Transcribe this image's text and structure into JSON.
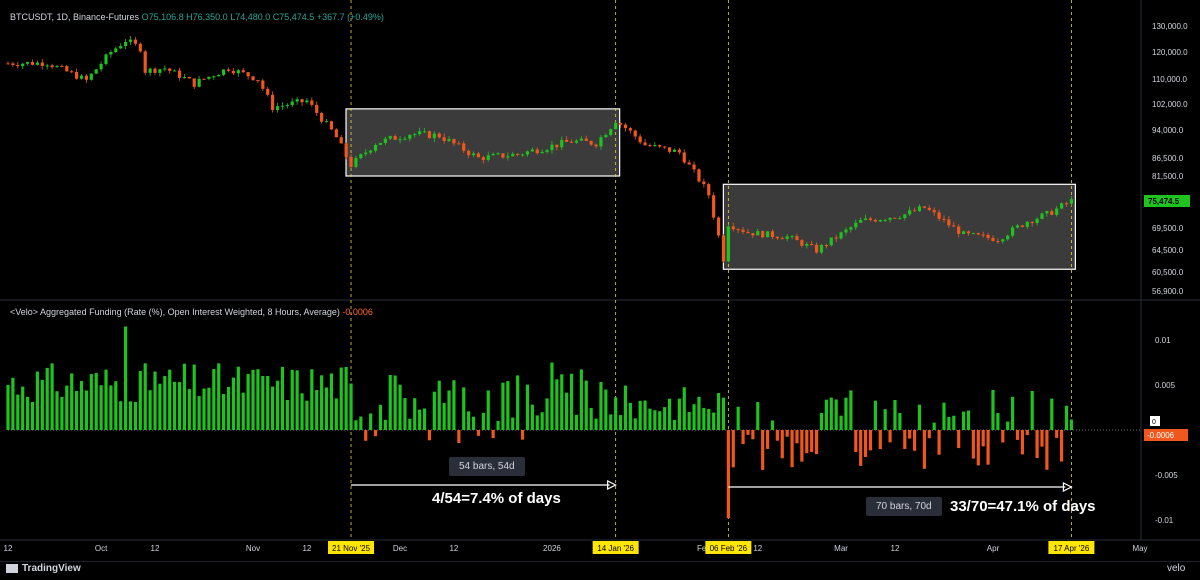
{
  "header": {
    "symbol": "BTCUSDT, 1D, Binance-Futures",
    "open": "O75,106.8",
    "high": "H76,350.0",
    "low": "L74,480.0",
    "close": "C75,474.5",
    "change": "+367.7 (+0.49%)"
  },
  "indicator": {
    "name": "<Velo> Aggregated Funding (Rate (%), Open Interest Weighted, 8 Hours, Average)",
    "value": "-0.0006"
  },
  "annotations": {
    "box1_label": "54 bars, 54d",
    "box1_text": "4/54=7.4% of days",
    "box2_label": "70 bars, 70d",
    "box2_text": "33/70=47.1% of days"
  },
  "colors": {
    "up": "#1ec31e",
    "down": "#f0571d",
    "box_fill": "#3b3b3b",
    "vline": "#e8d63a"
  },
  "footer": {
    "brand": "TradingView",
    "watermark": "velo"
  },
  "chart_data": [
    {
      "type": "candlestick",
      "title": "BTCUSDT, 1D, Binance-Futures",
      "x_range": [
        "2025-09-12",
        "2026-05-01"
      ],
      "price_axis_ticks": [
        130000,
        120000,
        110000,
        102000,
        94000,
        86500,
        81500,
        75474.5,
        69500,
        64500,
        60500,
        56900
      ],
      "price_axis_labels": [
        "130,000.0",
        "120,000.0",
        "110,000.0",
        "102,000.0",
        "94,000.0",
        "86,500.0",
        "81,500.0",
        "75,474.5",
        "69,500.0",
        "64,500.0",
        "60,500.0",
        "56,900.0"
      ],
      "last_price": 75474.5,
      "close_anchors": [
        [
          "2025-09-12",
          115800
        ],
        [
          "2025-09-20",
          116000
        ],
        [
          "2025-09-28",
          109500
        ],
        [
          "2025-10-03",
          120000
        ],
        [
          "2025-10-06",
          124500
        ],
        [
          "2025-10-09",
          121500
        ],
        [
          "2025-10-10",
          113000
        ],
        [
          "2025-10-14",
          114000
        ],
        [
          "2025-10-20",
          108500
        ],
        [
          "2025-10-27",
          114000
        ],
        [
          "2025-11-02",
          110000
        ],
        [
          "2025-11-05",
          101000
        ],
        [
          "2025-11-12",
          103000
        ],
        [
          "2025-11-18",
          92000
        ],
        [
          "2025-11-21",
          84500
        ],
        [
          "2025-11-26",
          90500
        ],
        [
          "2025-12-03",
          93000
        ],
        [
          "2025-12-09",
          92500
        ],
        [
          "2025-12-17",
          86500
        ],
        [
          "2025-12-25",
          87500
        ],
        [
          "2026-01-05",
          91000
        ],
        [
          "2026-01-10",
          90500
        ],
        [
          "2026-01-13",
          95000
        ],
        [
          "2026-01-14",
          97000
        ],
        [
          "2026-01-20",
          90000
        ],
        [
          "2026-01-27",
          88000
        ],
        [
          "2026-02-02",
          77000
        ],
        [
          "2026-02-05",
          63000
        ],
        [
          "2026-02-06",
          70500
        ],
        [
          "2026-02-10",
          68500
        ],
        [
          "2026-02-18",
          67500
        ],
        [
          "2026-02-24",
          64500
        ],
        [
          "2026-03-05",
          71000
        ],
        [
          "2026-03-14",
          72500
        ],
        [
          "2026-03-18",
          74000
        ],
        [
          "2026-03-26",
          68000
        ],
        [
          "2026-04-02",
          67000
        ],
        [
          "2026-04-08",
          71000
        ],
        [
          "2026-04-12",
          72500
        ],
        [
          "2026-04-17",
          75474.5
        ]
      ],
      "annotation_boxes": [
        {
          "from": "2025-11-21",
          "to": "2026-01-14",
          "low": 81500,
          "high": 100500
        },
        {
          "from": "2026-02-06",
          "to": "2026-04-17",
          "low": 61000,
          "high": 79500
        }
      ]
    },
    {
      "type": "bar",
      "title": "<Velo> Aggregated Funding (Rate (%), Open Interest Weighted, 8 Hours, Average)",
      "y_ticks": [
        0.01,
        0.005,
        0,
        -0.005,
        -0.01
      ],
      "y_tick_labels": [
        "0.01",
        "0.005",
        "0",
        "-0.005",
        "-0.01"
      ],
      "ylim": [
        -0.011,
        0.012
      ],
      "last_value": -0.0006,
      "note": "daily funding rate; green = positive, orange = negative",
      "negative_day_counts": [
        {
          "period": "2025-11-21 to 2026-01-14",
          "negative": 4,
          "total": 54,
          "pct": 7.4
        },
        {
          "period": "2026-02-06 to 2026-04-17",
          "negative": 33,
          "total": 70,
          "pct": 47.1
        }
      ],
      "sample_values": [
        [
          "2025-10-06",
          0.0115
        ],
        [
          "2025-10-12",
          0.0065
        ],
        [
          "2025-11-03",
          0.006
        ],
        [
          "2025-11-24",
          -0.0012
        ],
        [
          "2025-12-10",
          0.003
        ],
        [
          "2026-01-01",
          0.0075
        ],
        [
          "2026-02-06",
          -0.0098
        ],
        [
          "2026-03-06",
          -0.003
        ],
        [
          "2026-04-15",
          -0.0035
        ]
      ]
    }
  ],
  "x_axis": {
    "labels": [
      [
        "2025-09-12",
        "12"
      ],
      [
        "2025-10-01",
        "Oct"
      ],
      [
        "2025-10-12",
        "12"
      ],
      [
        "2025-11-01",
        "Nov"
      ],
      [
        "2025-11-12",
        "12"
      ],
      [
        "2025-12-01",
        "Dec"
      ],
      [
        "2025-12-12",
        "12"
      ],
      [
        "2026-01-01",
        "2026"
      ],
      [
        "2026-02-01",
        "Feb"
      ],
      [
        "2026-02-12",
        "12"
      ],
      [
        "2026-03-01",
        "Mar"
      ],
      [
        "2026-03-12",
        "12"
      ],
      [
        "2026-04-01",
        "Apr"
      ],
      [
        "2026-05-01",
        "May"
      ]
    ],
    "highlighted": [
      [
        "2025-11-21",
        "21 Nov '25"
      ],
      [
        "2026-01-14",
        "14 Jan '26"
      ],
      [
        "2026-02-06",
        "06 Feb '26"
      ],
      [
        "2026-04-17",
        "17 Apr '26"
      ]
    ]
  }
}
